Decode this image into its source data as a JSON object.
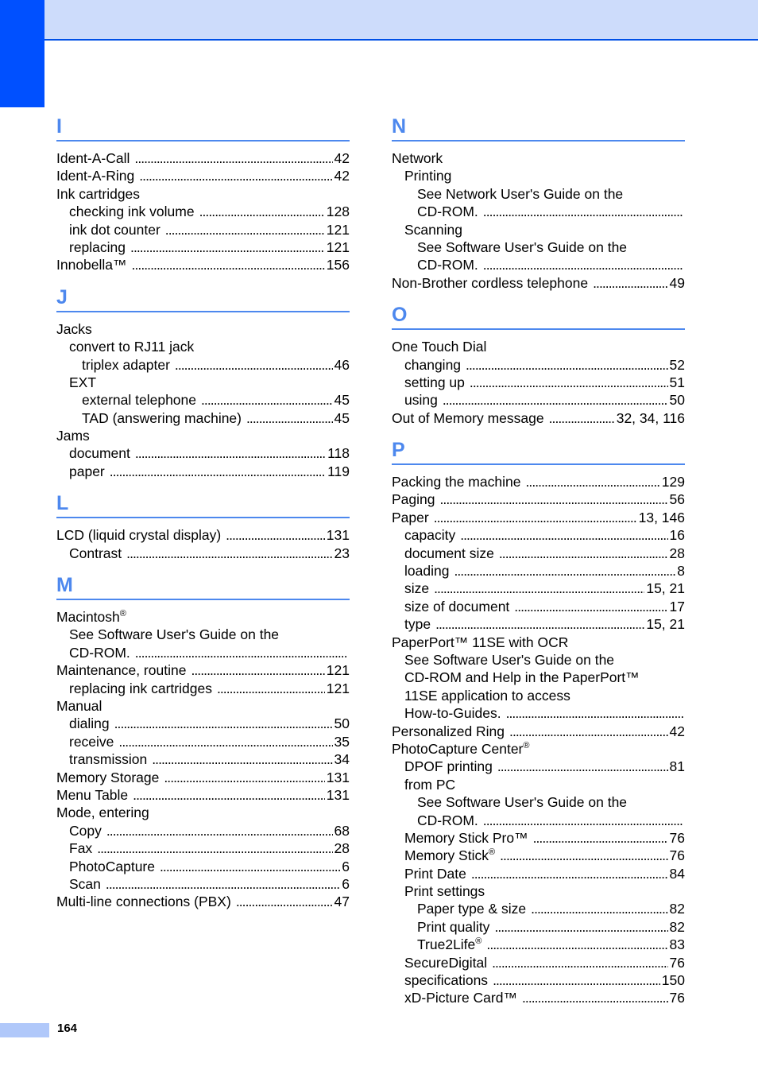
{
  "page": {
    "page_number": "164",
    "colors": {
      "tab": "#0050ff",
      "header_band": "#cddcfb",
      "accent": "#4d88ee",
      "footer_bar": "#b0c8fa"
    }
  },
  "left_column": [
    {
      "letter": "I",
      "entries": [
        {
          "level": 1,
          "label": "Ident-A-Call",
          "page": "42"
        },
        {
          "level": 1,
          "label": "Ident-A-Ring",
          "page": "42"
        },
        {
          "level": 1,
          "label": "Ink cartridges",
          "page": null
        },
        {
          "level": 2,
          "label": "checking ink volume",
          "page": "128"
        },
        {
          "level": 2,
          "label": "ink dot counter",
          "page": "121"
        },
        {
          "level": 2,
          "label": "replacing",
          "page": "121"
        },
        {
          "level": 1,
          "label": "Innobella™",
          "page": "156"
        }
      ]
    },
    {
      "letter": "J",
      "entries": [
        {
          "level": 1,
          "label": "Jacks",
          "page": null
        },
        {
          "level": 2,
          "label": "convert to RJ11 jack",
          "page": null
        },
        {
          "level": 3,
          "label": "triplex adapter",
          "page": "46"
        },
        {
          "level": 2,
          "label": "EXT",
          "page": null
        },
        {
          "level": 3,
          "label": "external telephone",
          "page": "45"
        },
        {
          "level": 3,
          "label": "TAD (answering machine)",
          "page": "45"
        },
        {
          "level": 1,
          "label": "Jams",
          "page": null
        },
        {
          "level": 2,
          "label": "document",
          "page": "118"
        },
        {
          "level": 2,
          "label": "paper",
          "page": "119"
        }
      ]
    },
    {
      "letter": "L",
      "entries": [
        {
          "level": 1,
          "label": "LCD (liquid crystal display)",
          "page": "131"
        },
        {
          "level": 2,
          "label": "Contrast",
          "page": "23"
        }
      ]
    },
    {
      "letter": "M",
      "entries": [
        {
          "level": 1,
          "label": "Macintosh",
          "sup": "®",
          "page": null
        },
        {
          "level": 2,
          "label": "See Software User's Guide on the",
          "page": null
        },
        {
          "level": 2,
          "label": "CD-ROM.",
          "page": ""
        },
        {
          "level": 1,
          "label": "Maintenance, routine",
          "page": "121"
        },
        {
          "level": 2,
          "label": "replacing ink cartridges",
          "page": "121"
        },
        {
          "level": 1,
          "label": "Manual",
          "page": null
        },
        {
          "level": 2,
          "label": "dialing",
          "page": "50"
        },
        {
          "level": 2,
          "label": "receive",
          "page": "35"
        },
        {
          "level": 2,
          "label": "transmission",
          "page": "34"
        },
        {
          "level": 1,
          "label": "Memory Storage",
          "page": "131"
        },
        {
          "level": 1,
          "label": "Menu Table",
          "page": "131"
        },
        {
          "level": 1,
          "label": "Mode, entering",
          "page": null
        },
        {
          "level": 2,
          "label": "Copy",
          "page": "68"
        },
        {
          "level": 2,
          "label": "Fax",
          "page": "28"
        },
        {
          "level": 2,
          "label": "PhotoCapture",
          "page": "6"
        },
        {
          "level": 2,
          "label": "Scan",
          "page": "6"
        },
        {
          "level": 1,
          "label": "Multi-line connections (PBX)",
          "page": "47"
        }
      ]
    }
  ],
  "right_column": [
    {
      "letter": "N",
      "entries": [
        {
          "level": 1,
          "label": "Network",
          "page": null
        },
        {
          "level": 2,
          "label": "Printing",
          "page": null
        },
        {
          "level": 3,
          "label": "See Network User's Guide on the",
          "page": null
        },
        {
          "level": 3,
          "label": "CD-ROM.",
          "page": ""
        },
        {
          "level": 2,
          "label": "Scanning",
          "page": null
        },
        {
          "level": 3,
          "label": "See Software User's Guide on the",
          "page": null
        },
        {
          "level": 3,
          "label": "CD-ROM.",
          "page": ""
        },
        {
          "level": 1,
          "label": "Non-Brother cordless telephone",
          "page": "49"
        }
      ]
    },
    {
      "letter": "O",
      "entries": [
        {
          "level": 1,
          "label": "One Touch Dial",
          "page": null
        },
        {
          "level": 2,
          "label": "changing",
          "page": "52"
        },
        {
          "level": 2,
          "label": "setting up",
          "page": "51"
        },
        {
          "level": 2,
          "label": "using",
          "page": "50"
        },
        {
          "level": 1,
          "label": "Out of Memory message",
          "page": "32, 34, 116"
        }
      ]
    },
    {
      "letter": "P",
      "entries": [
        {
          "level": 1,
          "label": "Packing the machine",
          "page": "129"
        },
        {
          "level": 1,
          "label": "Paging",
          "page": "56"
        },
        {
          "level": 1,
          "label": "Paper",
          "page": "13, 146"
        },
        {
          "level": 2,
          "label": "capacity",
          "page": "16"
        },
        {
          "level": 2,
          "label": "document size",
          "page": "28"
        },
        {
          "level": 2,
          "label": "loading",
          "page": "8"
        },
        {
          "level": 2,
          "label": "size",
          "page": "15, 21"
        },
        {
          "level": 2,
          "label": "size of document",
          "page": "17"
        },
        {
          "level": 2,
          "label": "type",
          "page": "15, 21"
        },
        {
          "level": 1,
          "label": "PaperPort™ 11SE with OCR",
          "page": null
        },
        {
          "level": 2,
          "label": "See Software User's Guide on the",
          "page": null
        },
        {
          "level": 2,
          "label": "CD-ROM and Help in the PaperPort™",
          "page": null
        },
        {
          "level": 2,
          "label": "11SE application to access",
          "page": null
        },
        {
          "level": 2,
          "label": "How-to-Guides.",
          "page": ""
        },
        {
          "level": 1,
          "label": "Personalized Ring",
          "page": "42"
        },
        {
          "level": 1,
          "label": "PhotoCapture Center",
          "sup": "®",
          "page": null
        },
        {
          "level": 2,
          "label": "DPOF printing",
          "page": "81"
        },
        {
          "level": 2,
          "label": "from PC",
          "page": null
        },
        {
          "level": 3,
          "label": "See Software User's Guide on the",
          "page": null
        },
        {
          "level": 3,
          "label": "CD-ROM.",
          "page": ""
        },
        {
          "level": 2,
          "label": "Memory Stick Pro™",
          "page": "76"
        },
        {
          "level": 2,
          "label": "Memory Stick",
          "sup": "®",
          "page": "76"
        },
        {
          "level": 2,
          "label": "Print Date",
          "page": "84"
        },
        {
          "level": 2,
          "label": "Print settings",
          "page": null
        },
        {
          "level": 3,
          "label": "Paper type & size",
          "page": "82"
        },
        {
          "level": 3,
          "label": "Print quality",
          "page": "82"
        },
        {
          "level": 3,
          "label": "True2Life",
          "sup": "®",
          "page": "83"
        },
        {
          "level": 2,
          "label": "SecureDigital",
          "page": "76"
        },
        {
          "level": 2,
          "label": "specifications",
          "page": "150"
        },
        {
          "level": 2,
          "label": "xD-Picture Card™",
          "page": "76"
        }
      ]
    }
  ]
}
